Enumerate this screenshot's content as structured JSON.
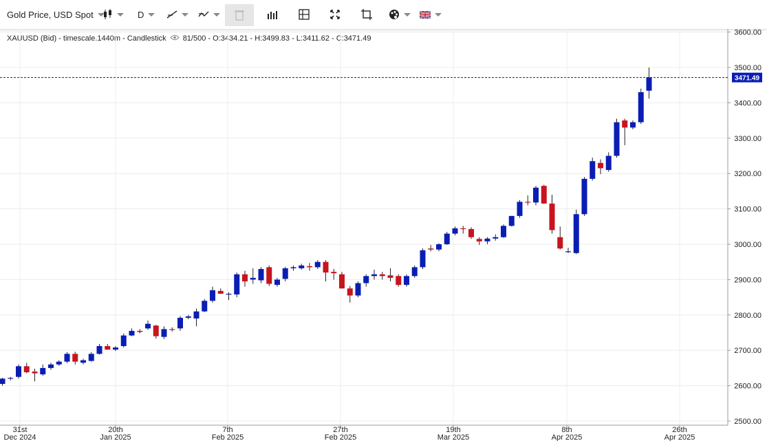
{
  "toolbar": {
    "instrument_label": "Gold Price, USD Spot",
    "timeframe_label": "D",
    "icons": [
      "candlestick-type-icon",
      "draw-line-icon",
      "indicators-icon",
      "delete-icon",
      "volume-icon",
      "crosshair-icon",
      "fullscreen-icon",
      "fit-icon",
      "palette-icon",
      "language-flag-icon"
    ]
  },
  "info": {
    "symbol": "XAUUSD (Bid) - timescale.1440m - Candlestick",
    "values": "81/500 - O:3434.21 - H:3499.83 - L:3411.62 - C:3471.49"
  },
  "colors": {
    "up": "#0a1eb4",
    "down": "#c8141e",
    "wick": "#222222",
    "grid": "#ececec",
    "last_price_bg": "#0a1eb4"
  },
  "chart_data": {
    "type": "candlestick",
    "ylim": [
      2500,
      3600
    ],
    "y_ticks": [
      "2500.00",
      "2600.00",
      "2700.00",
      "2800.00",
      "2900.00",
      "3000.00",
      "3100.00",
      "3200.00",
      "3300.00",
      "3400.00",
      "3500.00",
      "3600.00"
    ],
    "x_ticks": [
      {
        "label_day": "31st",
        "label_period": "Dec 2024"
      },
      {
        "label_day": "20th",
        "label_period": "Jan 2025"
      },
      {
        "label_day": "7th",
        "label_period": "Feb 2025"
      },
      {
        "label_day": "27th",
        "label_period": "Feb 2025"
      },
      {
        "label_day": "19th",
        "label_period": "Mar 2025"
      },
      {
        "label_day": "8th",
        "label_period": "Apr 2025"
      },
      {
        "label_day": "26th",
        "label_period": "Apr 2025"
      }
    ],
    "last_price": "3471.49",
    "candles": [
      [
        2605,
        2622,
        2600,
        2620
      ],
      [
        2620,
        2625,
        2615,
        2622
      ],
      [
        2625,
        2660,
        2620,
        2655
      ],
      [
        2655,
        2665,
        2635,
        2638
      ],
      [
        2640,
        2648,
        2612,
        2635
      ],
      [
        2632,
        2660,
        2628,
        2650
      ],
      [
        2650,
        2665,
        2645,
        2660
      ],
      [
        2660,
        2672,
        2656,
        2668
      ],
      [
        2668,
        2695,
        2664,
        2690
      ],
      [
        2690,
        2696,
        2660,
        2668
      ],
      [
        2665,
        2676,
        2660,
        2672
      ],
      [
        2670,
        2695,
        2668,
        2690
      ],
      [
        2690,
        2718,
        2688,
        2712
      ],
      [
        2712,
        2718,
        2702,
        2702
      ],
      [
        2702,
        2712,
        2698,
        2708
      ],
      [
        2712,
        2748,
        2708,
        2742
      ],
      [
        2742,
        2762,
        2740,
        2755
      ],
      [
        2755,
        2760,
        2748,
        2752
      ],
      [
        2762,
        2784,
        2758,
        2775
      ],
      [
        2770,
        2772,
        2733,
        2740
      ],
      [
        2738,
        2768,
        2732,
        2760
      ],
      [
        2760,
        2765,
        2753,
        2758
      ],
      [
        2762,
        2797,
        2755,
        2792
      ],
      [
        2792,
        2800,
        2788,
        2796
      ],
      [
        2790,
        2818,
        2768,
        2810
      ],
      [
        2810,
        2845,
        2808,
        2840
      ],
      [
        2840,
        2880,
        2835,
        2870
      ],
      [
        2868,
        2875,
        2860,
        2860
      ],
      [
        2860,
        2864,
        2842,
        2860
      ],
      [
        2858,
        2920,
        2850,
        2915
      ],
      [
        2915,
        2925,
        2880,
        2895
      ],
      [
        2900,
        2932,
        2888,
        2905
      ],
      [
        2898,
        2935,
        2890,
        2930
      ],
      [
        2935,
        2940,
        2882,
        2888
      ],
      [
        2885,
        2905,
        2880,
        2900
      ],
      [
        2902,
        2936,
        2895,
        2932
      ],
      [
        2932,
        2940,
        2925,
        2935
      ],
      [
        2932,
        2945,
        2928,
        2940
      ],
      [
        2938,
        2947,
        2925,
        2935
      ],
      [
        2935,
        2955,
        2930,
        2950
      ],
      [
        2950,
        2955,
        2895,
        2920
      ],
      [
        2922,
        2930,
        2900,
        2918
      ],
      [
        2915,
        2922,
        2875,
        2875
      ],
      [
        2875,
        2882,
        2835,
        2855
      ],
      [
        2855,
        2895,
        2850,
        2890
      ],
      [
        2890,
        2915,
        2880,
        2910
      ],
      [
        2910,
        2928,
        2900,
        2915
      ],
      [
        2915,
        2922,
        2900,
        2910
      ],
      [
        2912,
        2932,
        2895,
        2905
      ],
      [
        2910,
        2915,
        2880,
        2885
      ],
      [
        2885,
        2915,
        2880,
        2910
      ],
      [
        2910,
        2940,
        2905,
        2935
      ],
      [
        2935,
        2988,
        2930,
        2983
      ],
      [
        2988,
        2998,
        2980,
        2985
      ],
      [
        2985,
        3003,
        2980,
        3000
      ],
      [
        3000,
        3035,
        2998,
        3030
      ],
      [
        3030,
        3050,
        3025,
        3045
      ],
      [
        3045,
        3052,
        3030,
        3043
      ],
      [
        3043,
        3048,
        3015,
        3020
      ],
      [
        3015,
        3020,
        2998,
        3008
      ],
      [
        3008,
        3020,
        3000,
        3016
      ],
      [
        3016,
        3028,
        3010,
        3020
      ],
      [
        3020,
        3056,
        3018,
        3052
      ],
      [
        3052,
        3080,
        3050,
        3080
      ],
      [
        3080,
        3125,
        3075,
        3120
      ],
      [
        3120,
        3138,
        3110,
        3118
      ],
      [
        3118,
        3165,
        3110,
        3160
      ],
      [
        3165,
        3168,
        3115,
        3115
      ],
      [
        3115,
        3140,
        3030,
        3040
      ],
      [
        3020,
        3050,
        2985,
        2988
      ],
      [
        2980,
        2990,
        2975,
        2980
      ],
      [
        2975,
        3098,
        2972,
        3085
      ],
      [
        3085,
        3190,
        3080,
        3185
      ],
      [
        3185,
        3245,
        3180,
        3235
      ],
      [
        3230,
        3240,
        3198,
        3215
      ],
      [
        3210,
        3260,
        3205,
        3250
      ],
      [
        3250,
        3355,
        3245,
        3345
      ],
      [
        3350,
        3355,
        3280,
        3330
      ],
      [
        3330,
        3350,
        3325,
        3345
      ],
      [
        3345,
        3440,
        3340,
        3430
      ],
      [
        3434.21,
        3499.83,
        3411.62,
        3471.49
      ]
    ]
  }
}
